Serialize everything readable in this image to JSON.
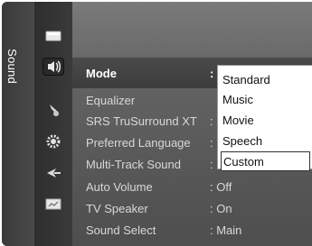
{
  "side_tab": {
    "label": "Sound"
  },
  "sidebar_icons": [
    {
      "name": "picture-icon"
    },
    {
      "name": "sound-icon"
    },
    {
      "name": "channel-icon"
    },
    {
      "name": "setup-icon"
    },
    {
      "name": "input-icon"
    },
    {
      "name": "application-icon"
    }
  ],
  "menu": {
    "items": [
      {
        "label": "Mode",
        "value": ":"
      },
      {
        "label": "Equalizer",
        "value": ""
      },
      {
        "label": "SRS TruSurround XT",
        "value": ":"
      },
      {
        "label": "Preferred Language",
        "value": ":"
      },
      {
        "label": "Multi-Track Sound",
        "value": ":"
      },
      {
        "label": "Auto Volume",
        "value": ": Off"
      },
      {
        "label": "TV Speaker",
        "value": ": On"
      },
      {
        "label": "Sound Select",
        "value": ": Main"
      }
    ]
  },
  "dropdown": {
    "options": [
      "Standard",
      "Music",
      "Movie",
      "Speech",
      "Custom"
    ],
    "selected": "Custom"
  },
  "colors": {
    "panel": "#5f5f5f",
    "selected_row": "#444444",
    "dropdown_bg": "#ffffff",
    "text_light": "#d8d8d8"
  }
}
